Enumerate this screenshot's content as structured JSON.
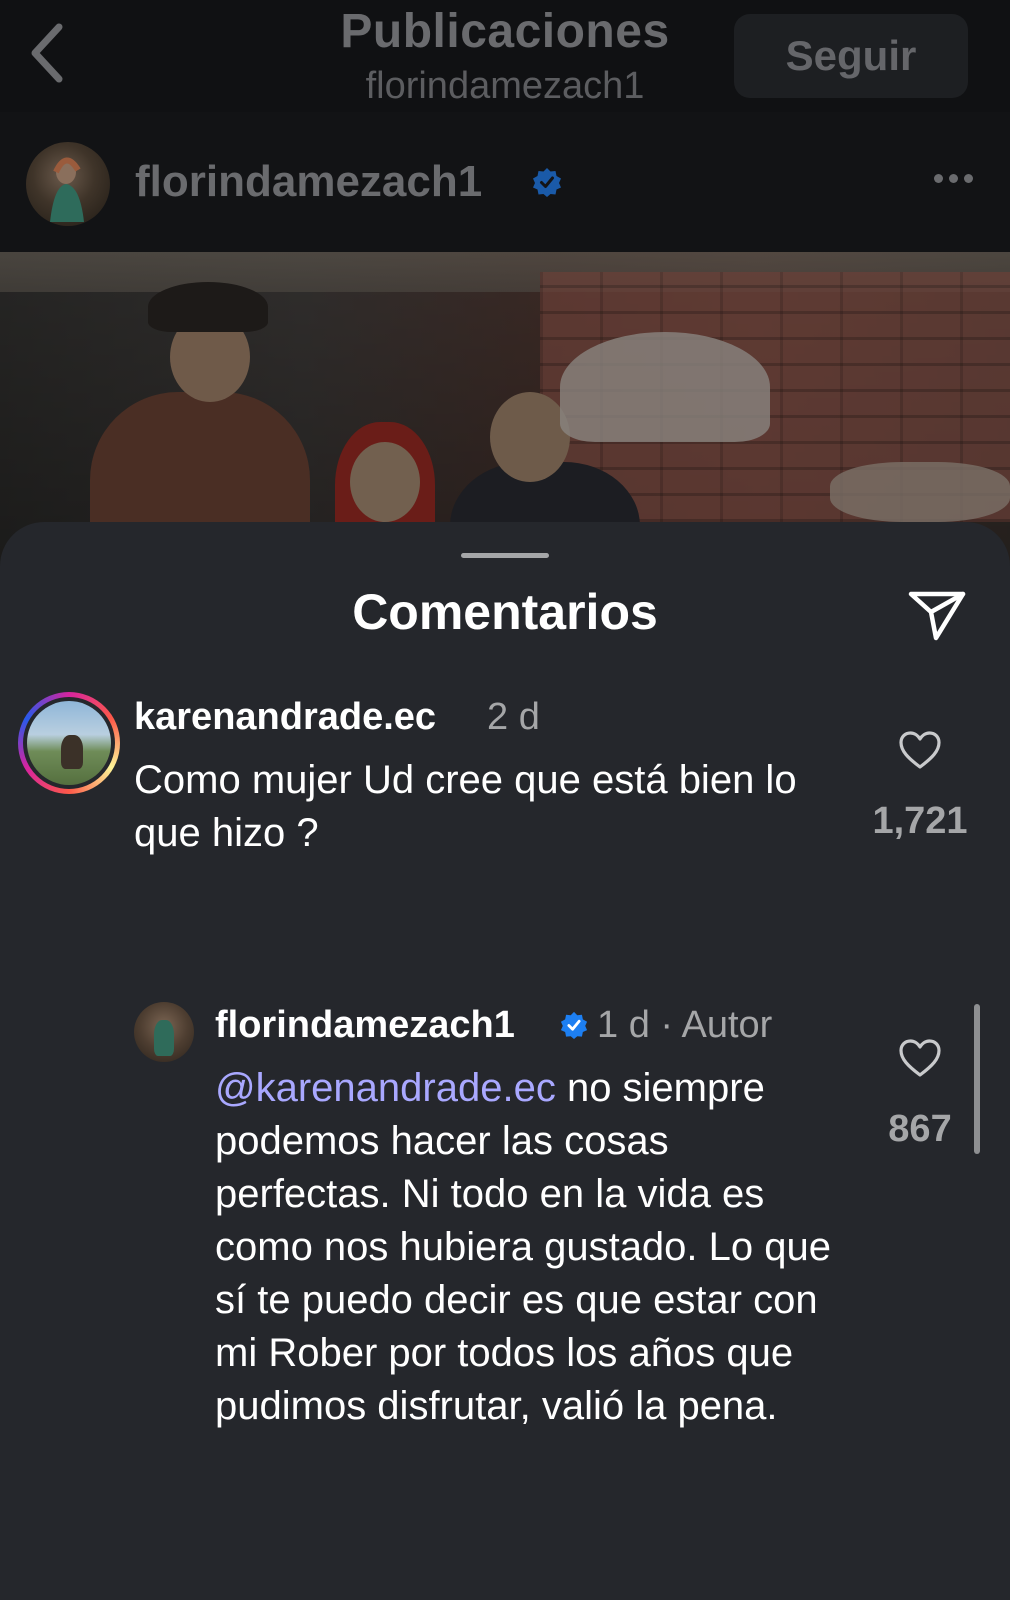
{
  "topbar": {
    "title": "Publicaciones",
    "subtitle": "florindamezach1",
    "follow_label": "Seguir",
    "back_icon": "chevron-left-icon"
  },
  "post": {
    "username": "florindamezach1",
    "verified": true,
    "more_icon": "more-horizontal-icon"
  },
  "comments_sheet": {
    "title": "Comentarios",
    "share_icon": "send-icon",
    "comments": [
      {
        "username": "karenandrade.ec",
        "time": "2 d",
        "text": "Como mujer Ud cree que está bien lo que hizo ?",
        "likes": "1,721",
        "has_story_ring": true
      },
      {
        "username": "florindamezach1",
        "verified": true,
        "time": "1 d · Autor",
        "mention": "@karenandrade.ec",
        "text": " no siempre podemos hacer las cosas perfectas. Ni todo en la vida es como nos hubiera gustado. Lo que sí te puedo decir es que estar con mi Rober por todos los años que pudimos disfrutar, valió la pena.",
        "likes": "867"
      }
    ]
  },
  "colors": {
    "accent_verified": "#1d7ff2",
    "mention": "#a9a8ff",
    "sheet_bg": "#25272c"
  }
}
